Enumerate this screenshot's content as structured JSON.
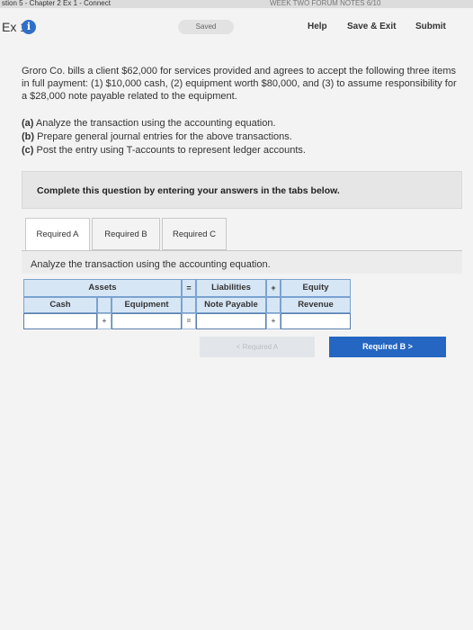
{
  "top_strip": {
    "left_text": "stion 5 - Chapter 2 Ex 1 - Connect",
    "right_text": "WEEK TWO FORUM NOTES 6/10"
  },
  "header": {
    "ex_label": "Ex 1",
    "info_icon": "i",
    "saved_label": "Saved",
    "help_label": "Help",
    "save_exit_label": "Save & Exit",
    "submit_label": "Submit"
  },
  "question": {
    "text": "Groro Co. bills a client $62,000 for services provided and agrees to accept the following three items in full payment: (1) $10,000 cash, (2) equipment worth $80,000, and (3) to assume responsibility for a $28,000 note payable related to the equipment.",
    "parts": [
      {
        "key": "(a)",
        "text": "Analyze the transaction using the accounting equation."
      },
      {
        "key": "(b)",
        "text": "Prepare general journal entries for the above transactions."
      },
      {
        "key": "(c)",
        "text": "Post the entry using T-accounts to represent ledger accounts."
      }
    ]
  },
  "instruction": "Complete this question by entering your answers in the tabs below.",
  "tabs": [
    {
      "label": "Required A",
      "active": true
    },
    {
      "label": "Required B",
      "active": false
    },
    {
      "label": "Required C",
      "active": false
    }
  ],
  "tab_content_title": "Analyze the transaction using the accounting equation.",
  "table": {
    "assets_label": "Assets",
    "equals_symbol": "=",
    "plus_symbol": "+",
    "liabilities_label": "Liabilities",
    "equity_label": "Equity",
    "cash_label": "Cash",
    "equipment_label": "Equipment",
    "note_payable_label": "Note Payable",
    "revenue_label": "Revenue",
    "cash_value": "",
    "equipment_value": "",
    "note_payable_value": "",
    "revenue_value": ""
  },
  "nav": {
    "prev_label": "< Required A",
    "next_label": "Required B  >"
  }
}
